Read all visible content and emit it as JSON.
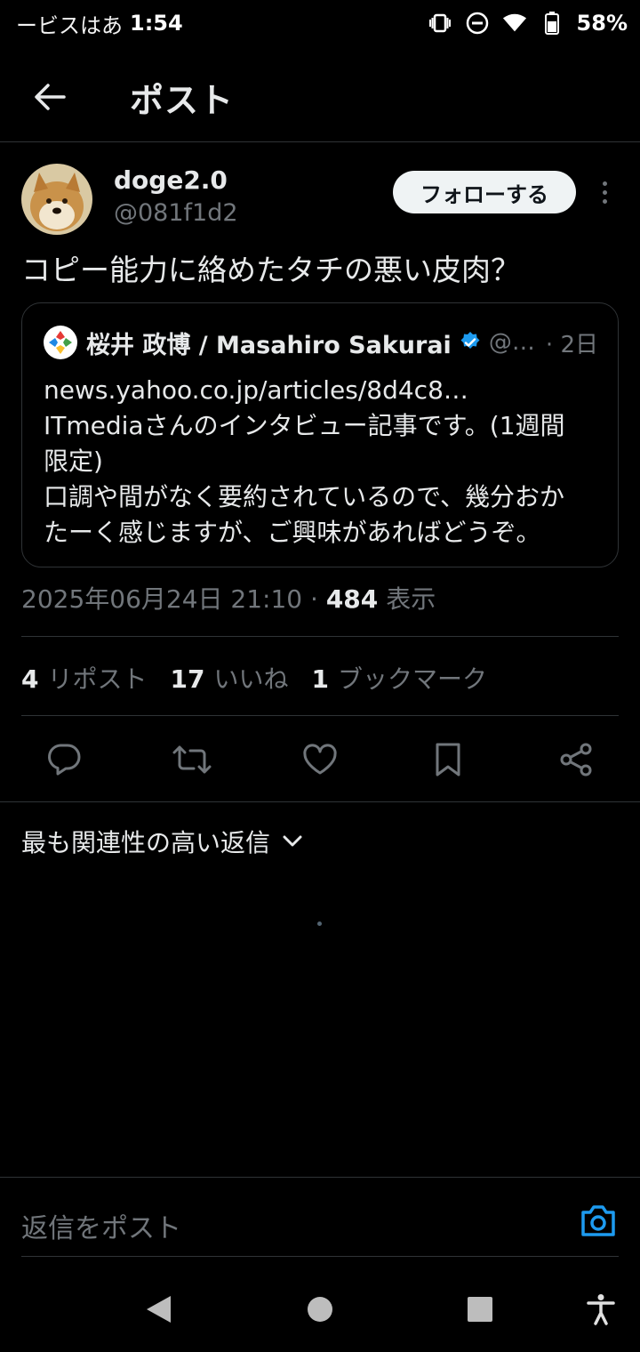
{
  "status_bar": {
    "carrier": "ービスはあ",
    "time": "1:54",
    "battery": "58%"
  },
  "header": {
    "title": "ポスト"
  },
  "post": {
    "author_name": "doge2.0",
    "author_handle": "@081f1d2",
    "follow_label": "フォローする",
    "text": "コピー能力に絡めたタチの悪い皮肉？",
    "timestamp": "2025年06月24日 21:10",
    "views_count": "484",
    "views_label": "表示"
  },
  "quote": {
    "name": "桜井 政博 / Masahiro Sakurai",
    "handle": "@…",
    "time": "· 2日",
    "lines": [
      "news.yahoo.co.jp/articles/8d4c8…",
      "ITmediaさんのインタビュー記事です。(1週間",
      "限定)",
      "口調や間がなく要約されているので、幾分おか",
      "たーく感じますが、ご興味があればどうぞ。"
    ]
  },
  "stats": {
    "reposts_count": "4",
    "reposts_label": "リポスト",
    "likes_count": "17",
    "likes_label": "いいね",
    "bookmarks_count": "1",
    "bookmarks_label": "ブックマーク"
  },
  "replies": {
    "sort_label": "最も関連性の高い返信"
  },
  "reply_bar": {
    "placeholder": "返信をポスト"
  },
  "colors": {
    "background": "#000000",
    "text_primary": "#e7e9ea",
    "text_secondary": "#71767b",
    "border": "#2f3336",
    "accent": "#1d9bf0"
  }
}
